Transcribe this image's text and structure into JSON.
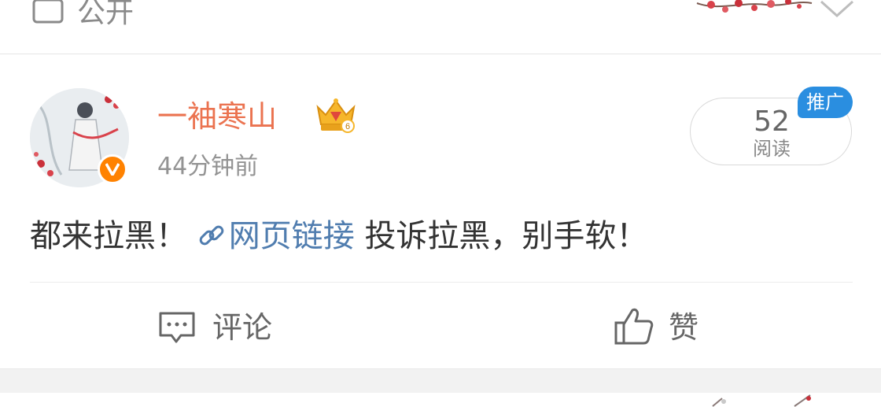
{
  "header": {
    "visibility_label": "公开"
  },
  "post": {
    "username": "一袖寒山",
    "vip_level": "6",
    "timestamp": "44分钟前",
    "reads": {
      "count": "52",
      "label": "阅读"
    },
    "promo_badge": "推广",
    "content": {
      "prefix": "都来拉黑！",
      "link_text": "网页链接",
      "suffix": " 投诉拉黑，别手软！"
    }
  },
  "actions": {
    "comment_label": "评论",
    "like_label": "赞"
  },
  "colors": {
    "username": "#eb7350",
    "link": "#507daf",
    "promo": "#2a8ee0",
    "verified": "#ff8200"
  }
}
